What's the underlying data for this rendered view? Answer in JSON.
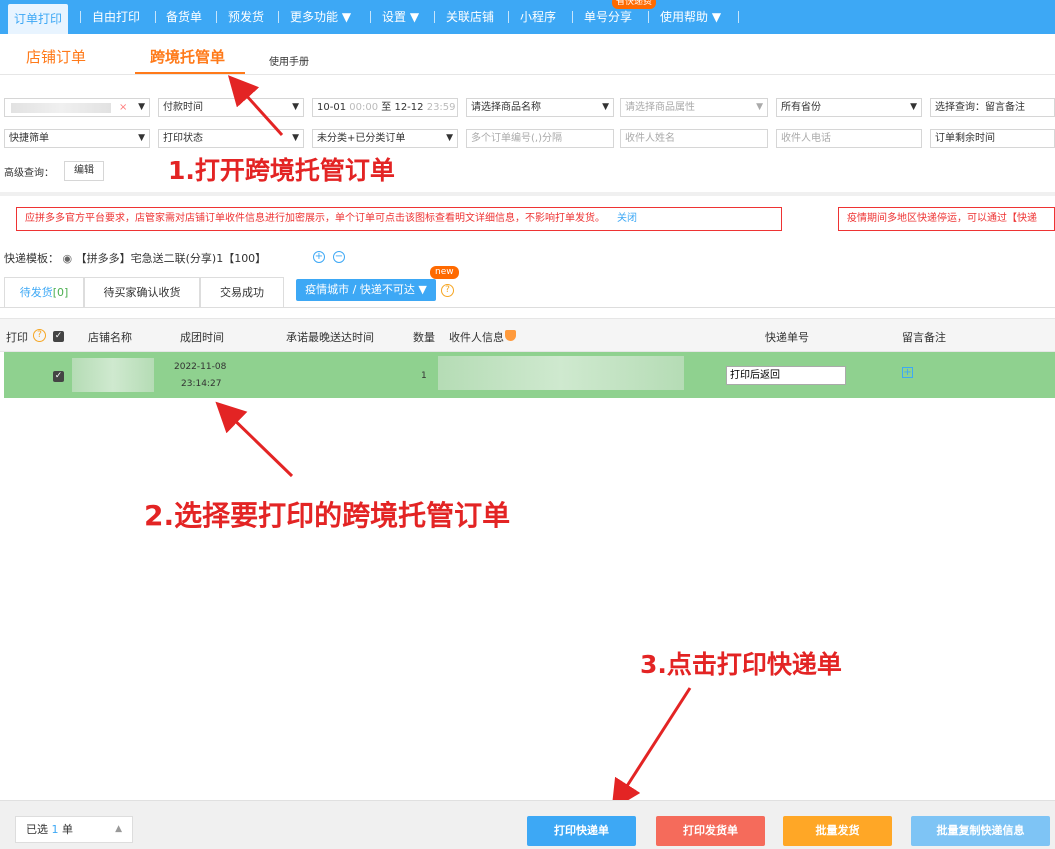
{
  "nav": {
    "items": [
      "订单打印",
      "自由打印",
      "备货单",
      "预发货",
      "更多功能 ▼",
      "设置 ▼",
      "关联店铺",
      "小程序",
      "单号分享",
      "使用帮助 ▼"
    ],
    "badge": "省快递费"
  },
  "subtabs": {
    "shop_orders": "店铺订单",
    "cross_border": "跨境托管单",
    "manual": "使用手册"
  },
  "filters": {
    "pay_time": "付款时间",
    "date_start": "10-01",
    "date_start_time": "00:00",
    "date_sep": "至",
    "date_end": "12-12",
    "date_end_time": "23:59",
    "product_name": "请选择商品名称",
    "product_attr": "请选择商品属性",
    "province": "所有省份",
    "select_query": "选择查询：留言备注",
    "quick_filter": "快捷筛单",
    "print_status": "打印状态",
    "classify": "未分类+已分类订单",
    "order_no_ph": "多个订单编号(,)分隔",
    "receiver_name_ph": "收件人姓名",
    "receiver_phone_ph": "收件人电话",
    "remaining_time": "订单剩余时间",
    "clear_x": "×",
    "advanced_label": "高级查询：",
    "edit": "编辑"
  },
  "notice": {
    "text": "应拼多多官方平台要求，店管家需对店铺订单收件信息进行加密展示，单个订单可点击该图标查看明文详细信息，不影响打单发货。",
    "close": "关闭",
    "text2": "疫情期间多地区快递停运，可以通过【快递"
  },
  "template": {
    "label": "快递模板：",
    "value": "【拼多多】宅急送二联(分享)1【100】",
    "plus": "+",
    "minus": "−"
  },
  "order_tabs": {
    "pending": "待发货",
    "pending_count": "[0]",
    "confirm": "待买家确认收货",
    "success": "交易成功",
    "epidemic_btn": "疫情城市 / 快递不可达 ▼",
    "new": "new",
    "help": "?"
  },
  "table": {
    "headers": {
      "print": "打印",
      "shop": "店铺名称",
      "group_time": "成团时间",
      "latest_time": "承诺最晚送达时间",
      "qty": "数量",
      "receiver": "收件人信息",
      "tracking": "快递单号",
      "remark": "留言备注"
    },
    "rows": [
      {
        "date": "2022-11-08",
        "time": "23:14:27",
        "qty": "1",
        "tracking": "打印后返回"
      }
    ]
  },
  "annotations": {
    "step1": "1.打开跨境托管订单",
    "step2": "2.选择要打印的跨境托管订单",
    "step3": "3.点击打印快递单"
  },
  "bottom": {
    "selected_prefix": "已选",
    "selected_count": "1",
    "selected_suffix": "单",
    "print_express": "打印快递单",
    "print_invoice": "打印发货单",
    "batch_ship": "批量发货",
    "batch_copy": "批量复制快递信息"
  },
  "colors": {
    "primary": "#3da8f5",
    "accent": "#ff7a1a",
    "annotation": "#e32424",
    "row_selected": "#8fd18f",
    "btn_invoice": "#f56b5b",
    "btn_ship": "#ffa726",
    "btn_copy": "#7ec4f5"
  }
}
